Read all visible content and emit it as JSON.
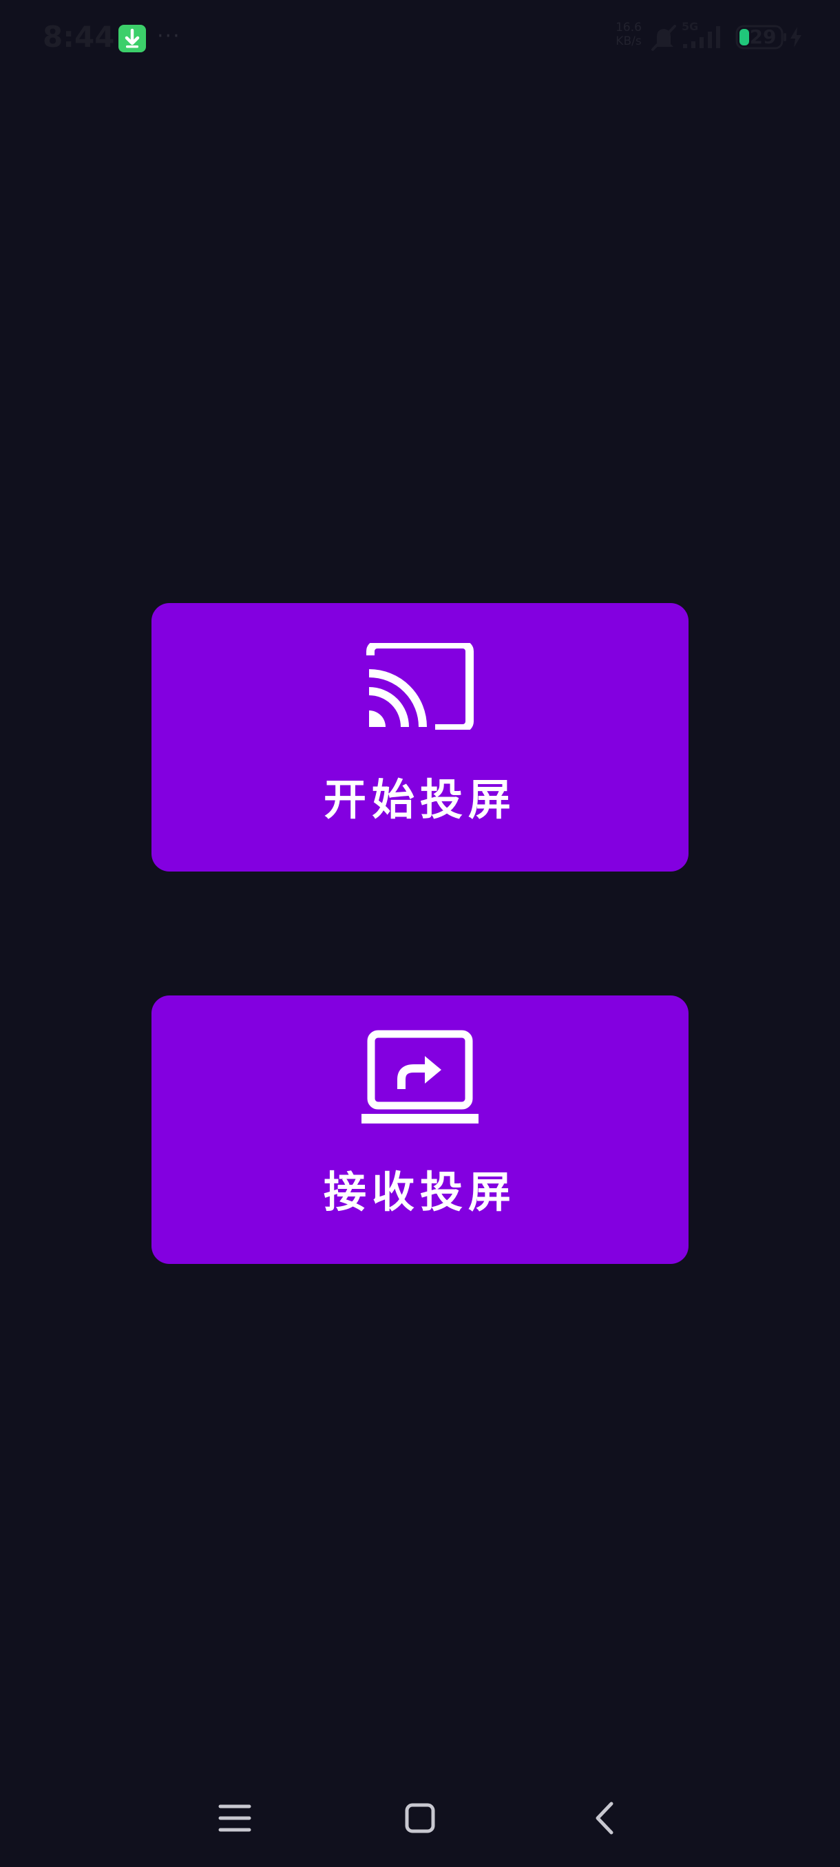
{
  "status_bar": {
    "time": "8:44",
    "notification_icon": "download-icon",
    "more_indicator": "···",
    "net_speed_value": "16.6",
    "net_speed_unit": "KB/s",
    "network_type": "5G",
    "battery_level": "29",
    "charging": true
  },
  "cards": {
    "cast": {
      "icon": "cast-icon",
      "label": "开始投屏"
    },
    "receive": {
      "icon": "screen-share-icon",
      "label": "接收投屏"
    }
  },
  "nav_bar": {
    "menu_icon": "menu-icon",
    "home_icon": "home-icon",
    "back_icon": "back-icon"
  },
  "colors": {
    "background": "#10101d",
    "card_accent": "#8300e0",
    "card_text": "#ffffff",
    "download_badge": "#3ccf6a",
    "battery_fill": "#20c77a",
    "nav_icon": "#c8c8d0"
  }
}
